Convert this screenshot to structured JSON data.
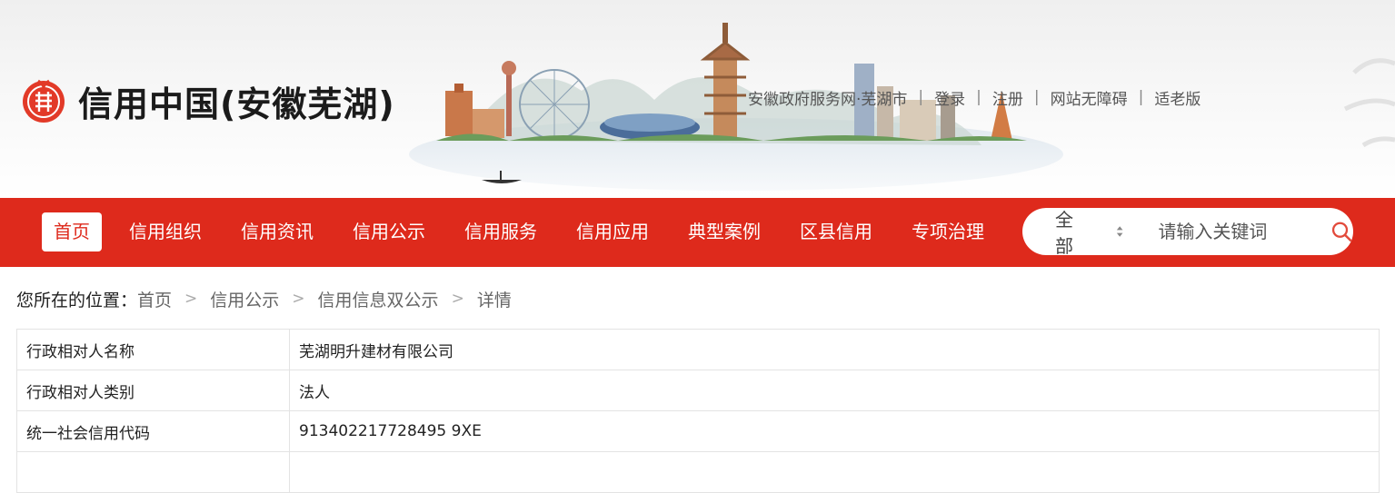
{
  "header": {
    "logo_text": "信用中国(安徽芜湖)",
    "topnav": [
      {
        "label": "安徽政府服务网·芜湖市"
      },
      {
        "label": "登录"
      },
      {
        "label": "注册"
      },
      {
        "label": "网站无障碍"
      },
      {
        "label": "适老版"
      }
    ],
    "separator": "|"
  },
  "colors": {
    "brand_red": "#de2a1c"
  },
  "nav": {
    "items": [
      {
        "label": "首页",
        "active": true
      },
      {
        "label": "信用组织"
      },
      {
        "label": "信用资讯"
      },
      {
        "label": "信用公示"
      },
      {
        "label": "信用服务"
      },
      {
        "label": "信用应用"
      },
      {
        "label": "典型案例"
      },
      {
        "label": "区县信用"
      },
      {
        "label": "专项治理"
      }
    ]
  },
  "search": {
    "scope": "全部",
    "placeholder": "请输入关键词",
    "icon": "search-icon"
  },
  "breadcrumb": {
    "label": "您所在的位置：",
    "items": [
      "首页",
      "信用公示",
      "信用信息双公示"
    ],
    "current": "详情",
    "separator": ">"
  },
  "detail": {
    "rows": [
      {
        "key": "行政相对人名称",
        "value": "芜湖明升建材有限公司"
      },
      {
        "key": "行政相对人类别",
        "value": "法人"
      },
      {
        "key": "统一社会信用代码",
        "value": "913402217728495 9XE"
      },
      {
        "key": "",
        "value": ""
      }
    ]
  }
}
